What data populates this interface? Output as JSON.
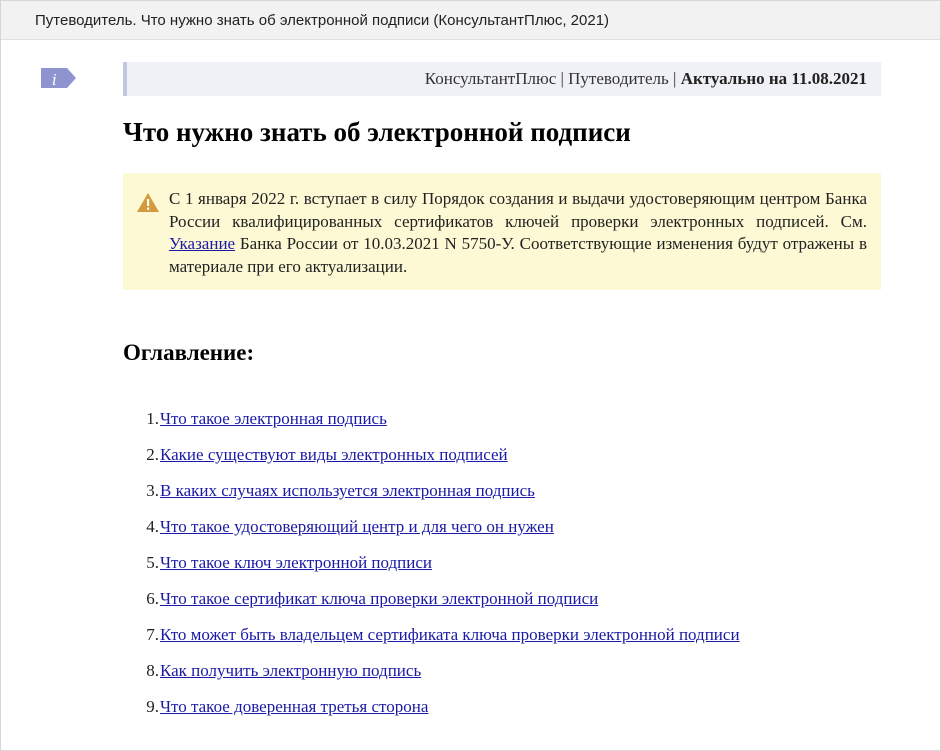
{
  "titlebar": {
    "text": "Путеводитель. Что нужно знать об электронной подписи (КонсультантПлюс, 2021)"
  },
  "header": {
    "source": "КонсультантПлюс",
    "separator": " | ",
    "section": "Путеводитель",
    "actual": "Актуально на 11.08.2021"
  },
  "document": {
    "title": "Что нужно знать об электронной подписи"
  },
  "warning": {
    "text_before": "С 1 января 2022 г. вступает в силу Порядок создания и выдачи удостоверяющим центром Банка России квалифицированных сертификатов ключей проверки электронных подписей. См. ",
    "link": "Указание",
    "text_after": " Банка России от 10.03.2021 N 5750-У. Соответствующие изменения будут отражены в материале при его актуализации."
  },
  "toc": {
    "heading": "Оглавление:",
    "items": [
      {
        "num": "1.",
        "label": "Что такое электронная подпись"
      },
      {
        "num": "2.",
        "label": "Какие существуют виды электронных подписей"
      },
      {
        "num": "3.",
        "label": "В каких случаях используется электронная подпись"
      },
      {
        "num": "4.",
        "label": "Что такое удостоверяющий центр и для чего он нужен"
      },
      {
        "num": "5.",
        "label": "Что такое ключ электронной подписи"
      },
      {
        "num": "6.",
        "label": "Что такое сертификат ключа проверки электронной подписи"
      },
      {
        "num": "7.",
        "label": "Кто может быть владельцем сертификата ключа проверки электронной подписи"
      },
      {
        "num": "8.",
        "label": "Как получить электронную подпись"
      },
      {
        "num": "9.",
        "label": "Что такое доверенная третья сторона"
      }
    ]
  },
  "icons": {
    "info": "info-icon",
    "warning": "warning-icon"
  },
  "colors": {
    "link": "#1a1aa6",
    "warning_bg": "#fdf9d4",
    "header_bg": "#f0f1f6",
    "info_icon": "#8e94cf",
    "warning_icon": "#d49a3e"
  }
}
